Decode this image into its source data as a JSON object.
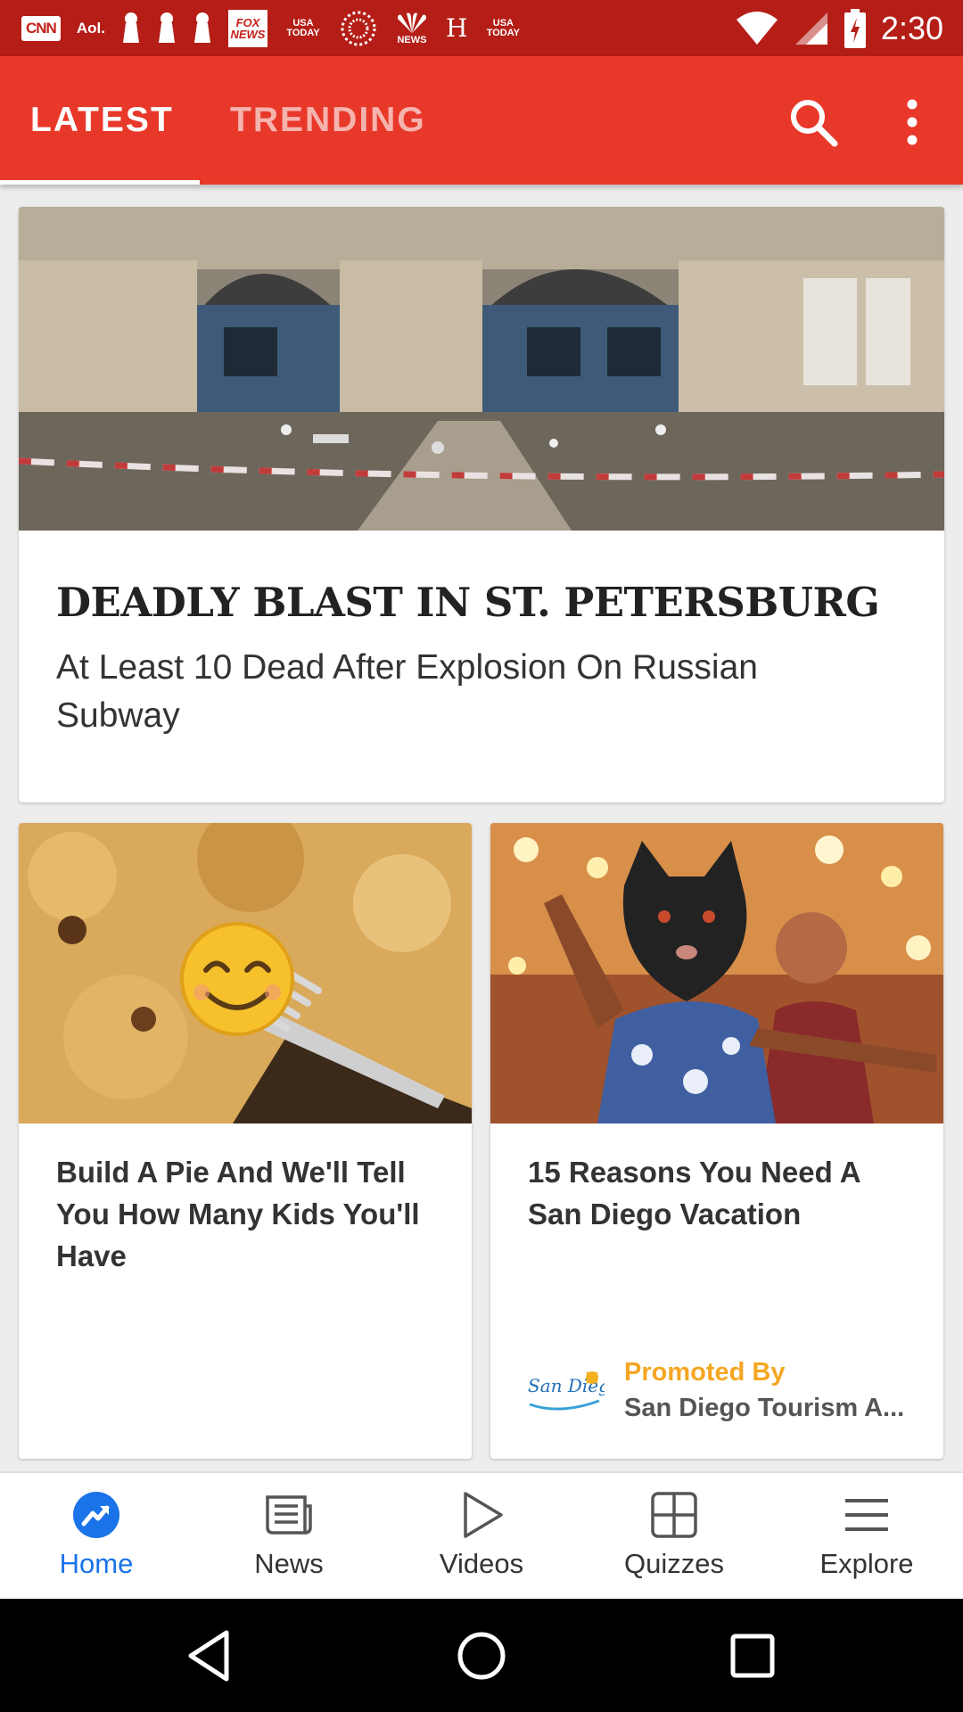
{
  "status_bar": {
    "notifications": [
      "CNN",
      "Aol.",
      "USA TODAY",
      "H",
      "USA TODAY"
    ],
    "fox_news": "FOX NEWS",
    "nbc_news": "NEWS",
    "time": "2:30",
    "icons": [
      "wifi-icon",
      "signal-icon",
      "battery-charging-icon"
    ]
  },
  "toolbar": {
    "tabs": [
      {
        "label": "LATEST",
        "active": true
      },
      {
        "label": "TRENDING",
        "active": false
      }
    ],
    "icons": [
      "search-icon",
      "more-vert-icon"
    ],
    "accent_color": "#e8382a"
  },
  "feed": {
    "hero": {
      "title": "DEADLY BLAST IN ST. PETERSBURG",
      "subtitle": "At Least 10 Dead After Explosion On Russian Subway"
    },
    "cards": [
      {
        "title": "Build A Pie And We'll Tell You How Many Kids You'll Have"
      },
      {
        "title": "15 Reasons You Need A San Diego Vacation",
        "promoted_label": "Promoted By",
        "sponsor": "San Diego Tourism A...",
        "sponsor_logo_text": "San Diego"
      }
    ]
  },
  "bottom_nav": {
    "items": [
      {
        "label": "Home",
        "icon": "trending-icon",
        "active": true
      },
      {
        "label": "News",
        "icon": "newspaper-icon",
        "active": false
      },
      {
        "label": "Videos",
        "icon": "play-icon",
        "active": false
      },
      {
        "label": "Quizzes",
        "icon": "grid-icon",
        "active": false
      },
      {
        "label": "Explore",
        "icon": "menu-icon",
        "active": false
      }
    ],
    "active_color": "#1a73e8"
  },
  "system_nav": {
    "icons": [
      "back-icon",
      "home-circle-icon",
      "recents-icon"
    ]
  }
}
